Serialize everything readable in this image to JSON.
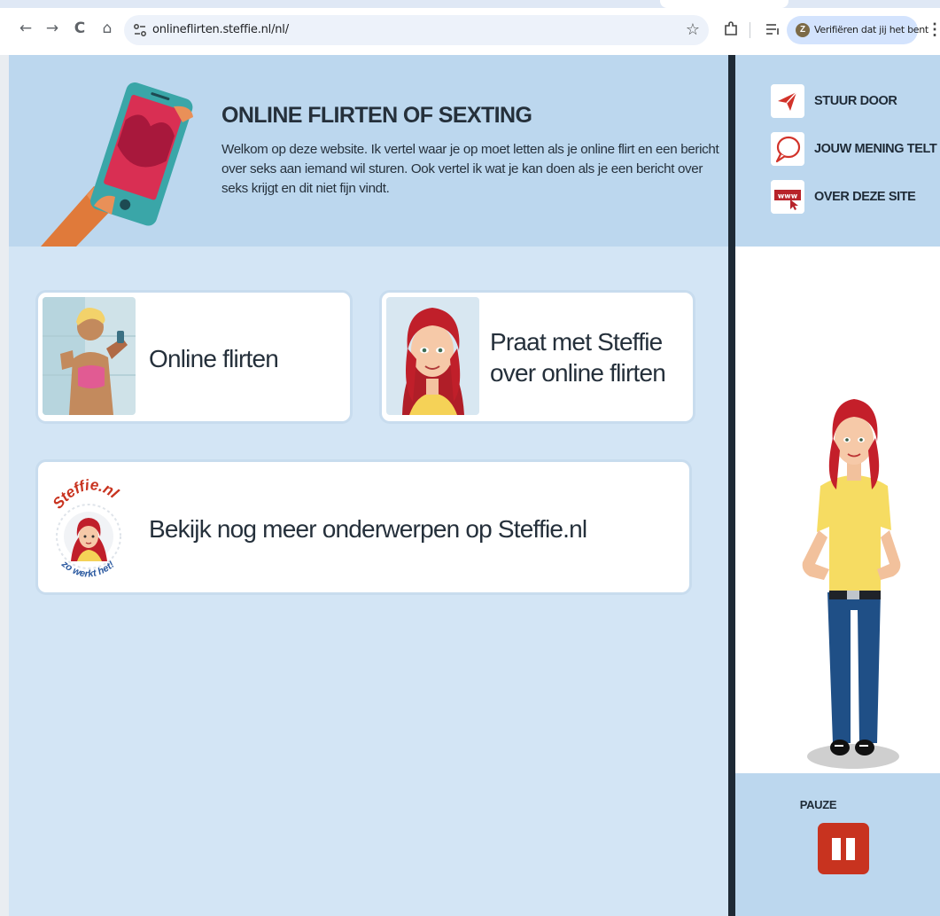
{
  "browser": {
    "url": "onlineflirten.steffie.nl/nl/",
    "nav": {
      "back_icon": "←",
      "forward_icon": "→",
      "reload_icon": "C",
      "home_icon": "⌂"
    },
    "verify_pill": {
      "badge": "Z",
      "label": "Verifiëren dat jij het bent"
    },
    "menu_icon": "⋮",
    "star_icon": "☆"
  },
  "banner": {
    "title": "ONLINE FLIRTEN OF SEXTING",
    "text": "Welkom op deze website. Ik vertel waar je op moet letten als je online flirt en een bericht over seks aan iemand wil sturen. Ook vertel ik wat je kan doen als je een bericht over seks krijgt en dit niet fijn vindt."
  },
  "cards": {
    "flirten": {
      "label": "Online flirten"
    },
    "praat": {
      "label": "Praat met Steffie over online flirten"
    },
    "meer": {
      "label": "Bekijk nog meer onderwerpen op Steffie.nl",
      "logo_top": "Steffie.nl",
      "logo_bottom": "zo werkt het!"
    }
  },
  "sidebar": {
    "items": [
      {
        "label": "STUUR DOOR",
        "icon": "paper-plane-icon"
      },
      {
        "label": "JOUW MENING TELT",
        "icon": "speech-bubble-icon"
      },
      {
        "label": "OVER DEZE SITE",
        "icon": "www-icon"
      }
    ],
    "pause_label": "PAUZE"
  },
  "colors": {
    "page_bg": "#d3e5f5",
    "banner_bg": "#bcd7ee",
    "accent_red": "#c8331f",
    "dark_bar": "#1e2a36"
  }
}
